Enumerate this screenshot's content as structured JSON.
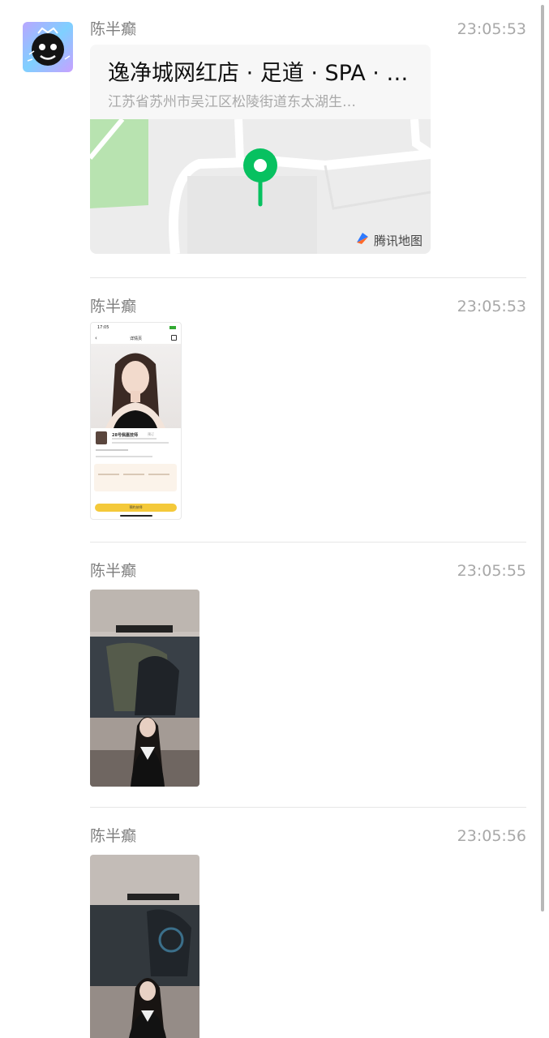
{
  "messages": [
    {
      "sender": "陈半癫",
      "time": "23:05:53",
      "type": "location",
      "location": {
        "title": "逸净城网红店 · 足道 · SPA · …",
        "address": "江苏省苏州市吴江区松陵街道东太湖生…",
        "map_brand": "腾讯地图"
      }
    },
    {
      "sender": "陈半癫",
      "time": "23:05:53",
      "type": "image",
      "phone": {
        "clock": "17:05",
        "nav_title": "详情页",
        "profile_name": "28号佩嘉技师",
        "badge": "预订",
        "book_button": "预约技师"
      }
    },
    {
      "sender": "陈半癫",
      "time": "23:05:55",
      "type": "video"
    },
    {
      "sender": "陈半癫",
      "time": "23:05:56",
      "type": "video"
    }
  ],
  "colors": {
    "pin": "#07c160",
    "map_green": "#b8e3b0",
    "book_button": "#f4c93a"
  }
}
